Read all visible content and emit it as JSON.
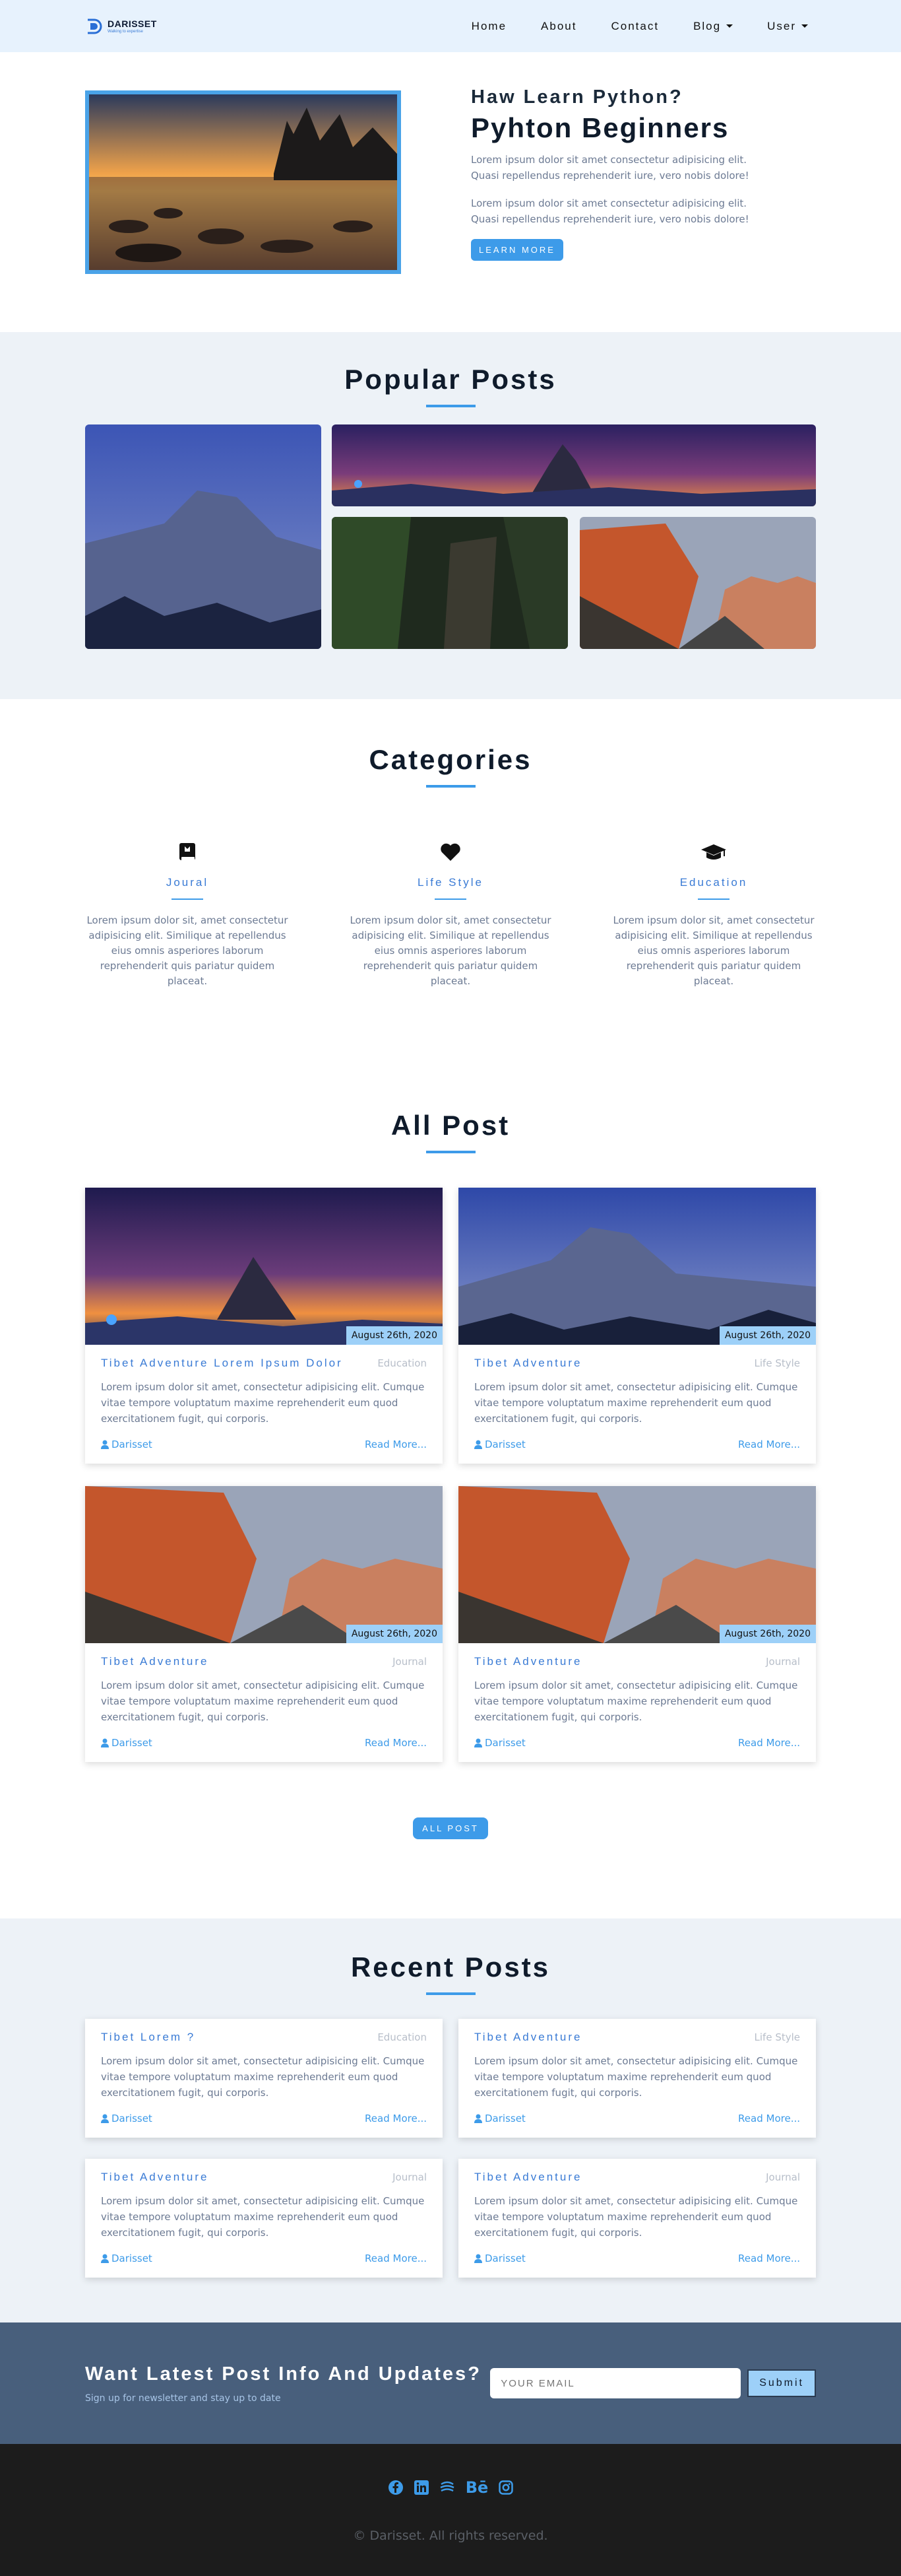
{
  "nav": {
    "logo_name": "DARISSET",
    "logo_tag": "Walking to expertise",
    "items": [
      {
        "label": "Home"
      },
      {
        "label": "About"
      },
      {
        "label": "Contact"
      },
      {
        "label": "Blog"
      },
      {
        "label": "User"
      }
    ]
  },
  "hero": {
    "subtitle": "Haw Learn Python?",
    "title": "Pyhton Beginners",
    "para1": "Lorem ipsum dolor sit amet consectetur adipisicing elit. Quasi repellendus reprehenderit iure, vero nobis dolore!",
    "para2": "Lorem ipsum dolor sit amet consectetur adipisicing elit. Quasi repellendus reprehenderit iure, vero nobis dolore!",
    "button": "LEARN MORE"
  },
  "popular": {
    "title": "Popular Posts"
  },
  "categories": {
    "title": "Categories",
    "items": [
      {
        "icon": "book-icon",
        "title": "Joural",
        "text": "Lorem ipsum dolor sit, amet consectetur adipisicing elit. Similique at repellendus eius omnis asperiores laborum reprehenderit quis pariatur quidem placeat."
      },
      {
        "icon": "heart-icon",
        "title": "Life Style",
        "text": "Lorem ipsum dolor sit, amet consectetur adipisicing elit. Similique at repellendus eius omnis asperiores laborum reprehenderit quis pariatur quidem placeat."
      },
      {
        "icon": "graduation-cap-icon",
        "title": "Education",
        "text": "Lorem ipsum dolor sit, amet consectetur adipisicing elit. Similique at repellendus eius omnis asperiores laborum reprehenderit quis pariatur quidem placeat."
      }
    ]
  },
  "allpost": {
    "title": "All Post",
    "button": "ALL POST",
    "posts": [
      {
        "date": "August 26th, 2020",
        "title": "Tibet Adventure Lorem Ipsum Dolor",
        "category": "Education",
        "text": "Lorem ipsum dolor sit amet, consectetur adipisicing elit. Cumque vitae tempore voluptatum maxime reprehenderit eum quod exercitationem fugit, qui corporis.",
        "author": "Darisset",
        "read": "Read More..."
      },
      {
        "date": "August 26th, 2020",
        "title": "Tibet Adventure",
        "category": "Life Style",
        "text": "Lorem ipsum dolor sit amet, consectetur adipisicing elit. Cumque vitae tempore voluptatum maxime reprehenderit eum quod exercitationem fugit, qui corporis.",
        "author": "Darisset",
        "read": "Read More..."
      },
      {
        "date": "August 26th, 2020",
        "title": "Tibet Adventure",
        "category": "Journal",
        "text": "Lorem ipsum dolor sit amet, consectetur adipisicing elit. Cumque vitae tempore voluptatum maxime reprehenderit eum quod exercitationem fugit, qui corporis.",
        "author": "Darisset",
        "read": "Read More..."
      },
      {
        "date": "August 26th, 2020",
        "title": "Tibet Adventure",
        "category": "Journal",
        "text": "Lorem ipsum dolor sit amet, consectetur adipisicing elit. Cumque vitae tempore voluptatum maxime reprehenderit eum quod exercitationem fugit, qui corporis.",
        "author": "Darisset",
        "read": "Read More..."
      }
    ]
  },
  "recent": {
    "title": "Recent Posts",
    "posts": [
      {
        "title": "Tibet Lorem ?",
        "category": "Education",
        "text": "Lorem ipsum dolor sit amet, consectetur adipisicing elit. Cumque vitae tempore voluptatum maxime reprehenderit eum quod exercitationem fugit, qui corporis.",
        "author": "Darisset",
        "read": "Read More..."
      },
      {
        "title": "Tibet Adventure",
        "category": "Life Style",
        "text": "Lorem ipsum dolor sit amet, consectetur adipisicing elit. Cumque vitae tempore voluptatum maxime reprehenderit eum quod exercitationem fugit, qui corporis.",
        "author": "Darisset",
        "read": "Read More..."
      },
      {
        "title": "Tibet Adventure",
        "category": "Journal",
        "text": "Lorem ipsum dolor sit amet, consectetur adipisicing elit. Cumque vitae tempore voluptatum maxime reprehenderit eum quod exercitationem fugit, qui corporis.",
        "author": "Darisset",
        "read": "Read More..."
      },
      {
        "title": "Tibet Adventure",
        "category": "Journal",
        "text": "Lorem ipsum dolor sit amet, consectetur adipisicing elit. Cumque vitae tempore voluptatum maxime reprehenderit eum quod exercitationem fugit, qui corporis.",
        "author": "Darisset",
        "read": "Read More..."
      }
    ]
  },
  "newsletter": {
    "title": "Want Latest Post Info And Updates?",
    "subtitle": "Sign up for newsletter and stay up to date",
    "placeholder": "YOUR EMAIL",
    "button": "Submit"
  },
  "footer": {
    "socials": [
      "facebook-icon",
      "linkedin-icon",
      "dribbble-icon",
      "behance-icon",
      "instagram-icon"
    ],
    "behance_text": "Bē",
    "copyright": "© Darisset. All rights reserved."
  },
  "colors": {
    "accent": "#3d9be9",
    "nav_bg": "#e7f2fd",
    "section_bg": "#edf2f7",
    "newsletter_bg": "#485f7c",
    "footer_bg": "#1c1c1c"
  }
}
